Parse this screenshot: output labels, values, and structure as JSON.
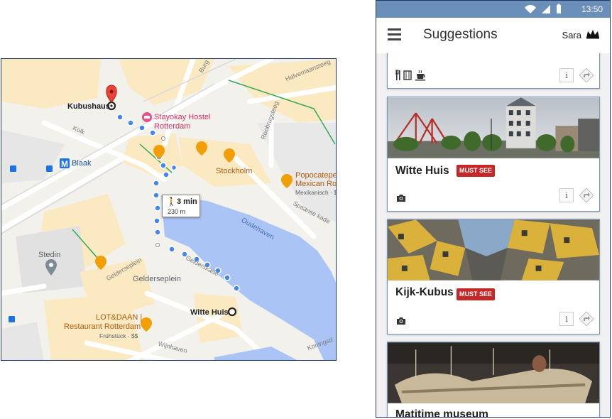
{
  "map": {
    "labels": {
      "kubushaus": "Kubushaus",
      "stayokay_line1": "Stayokay Hostel",
      "stayokay_line2": "Rotterdam",
      "kolk": "Kolk",
      "blaak": "Blaak",
      "stockholm": "Stockholm",
      "popocatepetl_line1": "Popocatepetl",
      "popocatepetl_line2": "Mexican Rotter",
      "popocatepetl_line3": "Mexikanisch · $$",
      "spaanse": "Spaanse kade",
      "oudehaven": "Oudehaven",
      "stedin": "Stedin",
      "gelderseplein_street": "Gelderseplein",
      "gelderseplein": "Gelderseplein",
      "gelderskade": "Gelderskade",
      "lotdaan_line1": "LOT&DAAN |",
      "lotdaan_line2": "Restaurant Rotterdam",
      "lotdaan_line3": "Frühstück · $$",
      "witte_huis": "Witte Huis",
      "wijnhaven": "Wijnhaven",
      "halvemaan": "Halvemaansteeg",
      "roobrug": "Roobrugsteeg",
      "burg": "Burg",
      "koning": "Koningsd"
    },
    "walk": {
      "time": "3 min",
      "distance": "230 m"
    },
    "colors": {
      "route": "#4285f4",
      "water": "#aac4f5",
      "pin": "#ea4335",
      "poi": "#f29f05"
    }
  },
  "phone": {
    "status": {
      "time": "13:50"
    },
    "app_bar": {
      "title": "Suggestions",
      "user": "Sara"
    },
    "cards": [
      {
        "title": "",
        "icons": [
          "fork-knife-icon",
          "ticket-icon",
          "coffee-icon"
        ]
      },
      {
        "title": "Witte Huis",
        "badge": "MUST SEE"
      },
      {
        "title": "Kijk-Kubus",
        "badge": "MUST SEE"
      },
      {
        "title": "Matitime museum"
      }
    ],
    "info_label": "i"
  }
}
